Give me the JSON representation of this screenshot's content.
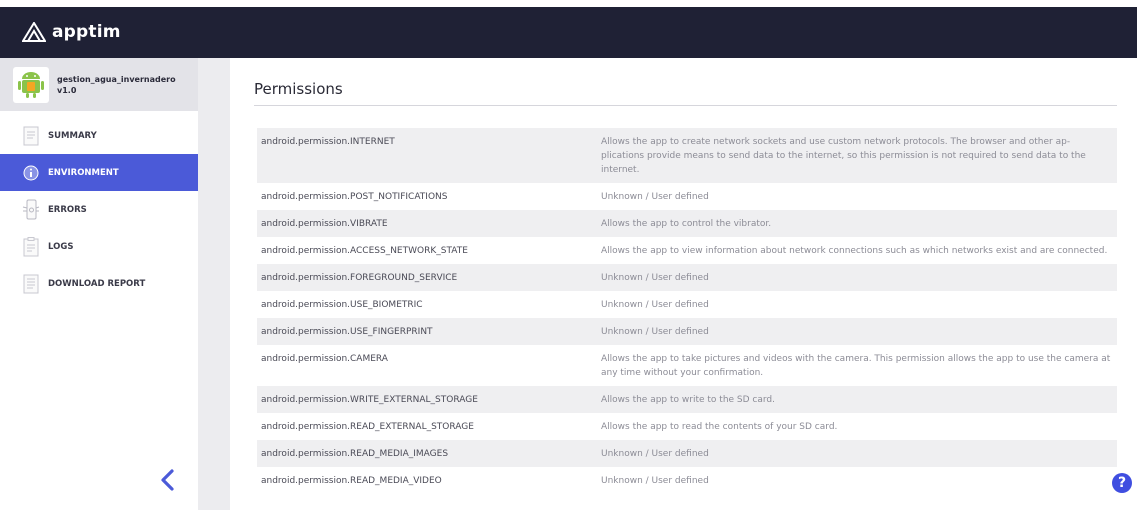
{
  "brand": {
    "name": "apptim"
  },
  "app": {
    "name": "gestion_agua_invernadero",
    "version": "v1.0"
  },
  "nav": {
    "items": [
      {
        "label": "SUMMARY",
        "icon": "document-icon",
        "active": false
      },
      {
        "label": "ENVIRONMENT",
        "icon": "info-icon",
        "active": true
      },
      {
        "label": "ERRORS",
        "icon": "bug-phone-icon",
        "active": false
      },
      {
        "label": "LOGS",
        "icon": "log-file-icon",
        "active": false
      },
      {
        "label": "DOWNLOAD REPORT",
        "icon": "report-icon",
        "active": false
      }
    ],
    "collapse_icon": "chevron-left-icon"
  },
  "main": {
    "title": "Permissions",
    "permissions": [
      {
        "name": "android.permission.INTERNET",
        "description": "Allows the app to create network sockets and use custom network protocols. The browser and other ap-plications provide means to send data to the internet, so this permission is not required to send data to the internet."
      },
      {
        "name": "android.permission.POST_NOTIFICATIONS",
        "description": "Unknown / User defined"
      },
      {
        "name": "android.permission.VIBRATE",
        "description": "Allows the app to control the vibrator."
      },
      {
        "name": "android.permission.ACCESS_NETWORK_STATE",
        "description": "Allows the app to view information about network connections such as which networks exist and are connected."
      },
      {
        "name": "android.permission.FOREGROUND_SERVICE",
        "description": "Unknown / User defined"
      },
      {
        "name": "android.permission.USE_BIOMETRIC",
        "description": "Unknown / User defined"
      },
      {
        "name": "android.permission.USE_FINGERPRINT",
        "description": "Unknown / User defined"
      },
      {
        "name": "android.permission.CAMERA",
        "description": "Allows the app to take pictures and videos with the camera. This permission allows the app to use the camera at any time without your confirmation."
      },
      {
        "name": "android.permission.WRITE_EXTERNAL_STORAGE",
        "description": "Allows the app to write to the SD card."
      },
      {
        "name": "android.permission.READ_EXTERNAL_STORAGE",
        "description": "Allows the app to read the contents of your SD card."
      },
      {
        "name": "android.permission.READ_MEDIA_IMAGES",
        "description": "Unknown / User defined"
      },
      {
        "name": "android.permission.READ_MEDIA_VIDEO",
        "description": "Unknown / User defined"
      }
    ]
  },
  "help": {
    "label": "?",
    "icon": "help-icon"
  },
  "colors": {
    "topbar": "#1f2135",
    "accent": "#4b5ad8",
    "sidebar_card": "#e3e3e8",
    "row_shade": "#efeff1"
  }
}
